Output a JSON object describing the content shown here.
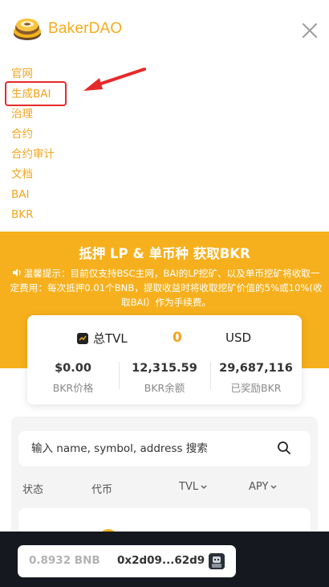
{
  "header": {
    "brand": "BakerDAO",
    "icons": {
      "logo": "bakerdao-logo",
      "close": "close-icon"
    }
  },
  "nav": {
    "items": [
      {
        "label": "官网"
      },
      {
        "label": "生成BAI"
      },
      {
        "label": "治理"
      },
      {
        "label": "合约"
      },
      {
        "label": "合约审计"
      },
      {
        "label": "文档"
      },
      {
        "label": "BAI"
      },
      {
        "label": "BKR"
      }
    ]
  },
  "banner": {
    "title": "抵押 LP & 单币种 获取BKR",
    "notice": "温馨提示：目前仅支持BSC主网，BAI的LP挖矿、以及单币挖矿将收取一定费用：每次抵押0.01个BNB，提取收益时将收取挖矿价值的5%或10%(收取BAI）作为手续费。",
    "notice_icon": "speaker-icon"
  },
  "tvl": {
    "label": "总TVL",
    "value": "0",
    "unit": "USD",
    "stats": [
      {
        "value": "$0.00",
        "label": "BKR价格"
      },
      {
        "value": "12,315.59",
        "label": "BKR余额"
      },
      {
        "value": "29,687,116",
        "label": "已奖励BKR"
      }
    ]
  },
  "pools": {
    "search_placeholder": "输入 name, symbol, address 搜索",
    "columns": [
      {
        "label": "状态"
      },
      {
        "label": "代币"
      },
      {
        "label": "TVL"
      },
      {
        "label": "APY"
      }
    ]
  },
  "wallet": {
    "balance": "0.8932 BNB",
    "address": "0x2d09...62d9"
  },
  "colors": {
    "accent": "#f6b01d",
    "highlight_box": "#e62a2a",
    "bottom_bar": "#15181e"
  }
}
